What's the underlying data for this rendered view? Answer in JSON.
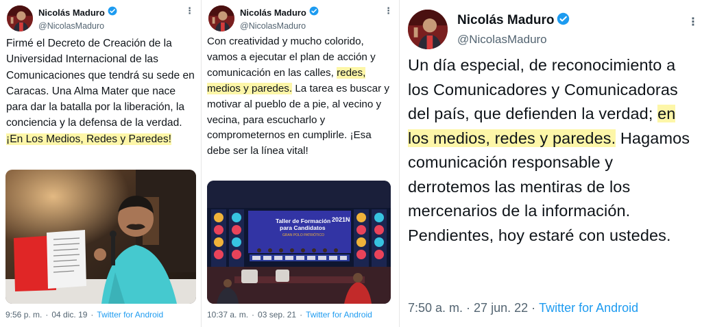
{
  "tweets": [
    {
      "author_name": "Nicolás Maduro",
      "author_handle": "@NicolasMaduro",
      "text_plain": "Firmé el Decreto de Creación de la Universidad Internacional de las Comunicaciones que tendrá su sede en Caracas. Una Alma Mater que nace para dar la batalla por la liberación, la conciencia y la defensa de la verdad. ",
      "text_highlight": "¡En Los Medios, Redes y Paredes!",
      "text_after": "",
      "time": "9:56 p. m.",
      "date": "04 dic. 19",
      "separator": "·",
      "source": "Twitter for Android",
      "more": "⋮"
    },
    {
      "author_name": "Nicolás Maduro",
      "author_handle": "@NicolasMaduro",
      "text_plain": "Con creatividad y mucho colorido, vamos a ejecutar el plan de acción y comunicación en las calles, ",
      "text_highlight": "redes, medios y paredes.",
      "text_after": " La tarea es buscar y motivar al pueblo de a pie, al vecino y vecina, para escucharlo y comprometernos en cumplirle. ¡Esa debe ser la línea vital!",
      "time": "10:37 a. m.",
      "date": "03 sep. 21",
      "separator": "·",
      "source": "Twitter for Android",
      "more": "⋮",
      "media_banner_line1": "Taller de Formación",
      "media_banner_line2": "para Candidatos",
      "media_banner_line3": "GRAN POLO PATRIÓTICO",
      "media_banner_tag": "2021N"
    },
    {
      "author_name": "Nicolás Maduro",
      "author_handle": "@NicolasMaduro",
      "text_plain": "Un día especial, de reconocimiento a los Comunicadores y Comunicadoras del país, que defienden la verdad; ",
      "text_highlight": "en los medios, redes y paredes.",
      "text_after": " Hagamos comunicación responsable y derrotemos las mentiras de los mercenarios de la información. Pendientes, hoy estaré con ustedes.",
      "time": "7:50 a. m.",
      "date": "27 jun. 22",
      "separator": "·",
      "source": "Twitter for Android",
      "more": "⋮"
    }
  ],
  "colors": {
    "highlight": "#fdf6a8",
    "link": "#1d9bf0",
    "verified": "#1d9bf0",
    "muted": "#536471",
    "text": "#0f1419"
  }
}
